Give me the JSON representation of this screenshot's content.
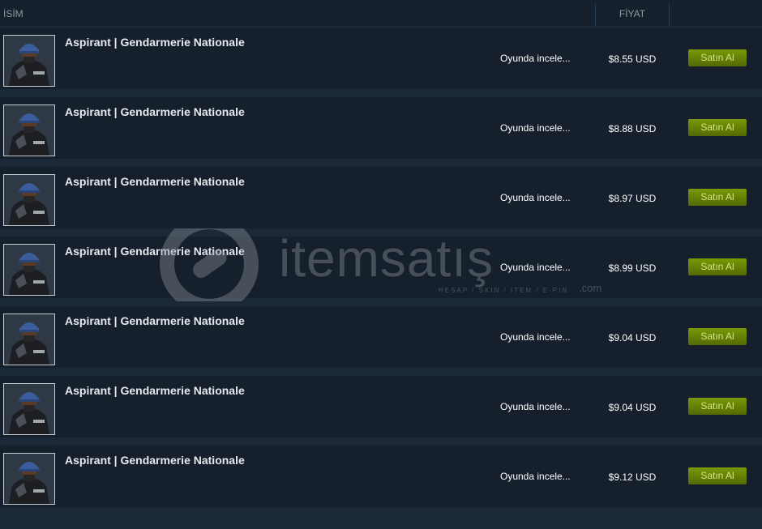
{
  "header": {
    "name_label": "İSİM",
    "price_label": "FİYAT"
  },
  "rows": [
    {
      "name": "Aspirant | Gendarmerie Nationale",
      "inspect": "Oyunda incele...",
      "price": "$8.55 USD",
      "buy": "Satın Al"
    },
    {
      "name": "Aspirant | Gendarmerie Nationale",
      "inspect": "Oyunda incele...",
      "price": "$8.88 USD",
      "buy": "Satın Al"
    },
    {
      "name": "Aspirant | Gendarmerie Nationale",
      "inspect": "Oyunda incele...",
      "price": "$8.97 USD",
      "buy": "Satın Al"
    },
    {
      "name": "Aspirant | Gendarmerie Nationale",
      "inspect": "Oyunda incele...",
      "price": "$8.99 USD",
      "buy": "Satın Al"
    },
    {
      "name": "Aspirant | Gendarmerie Nationale",
      "inspect": "Oyunda incele...",
      "price": "$9.04 USD",
      "buy": "Satın Al"
    },
    {
      "name": "Aspirant | Gendarmerie Nationale",
      "inspect": "Oyunda incele...",
      "price": "$9.04 USD",
      "buy": "Satın Al"
    },
    {
      "name": "Aspirant | Gendarmerie Nationale",
      "inspect": "Oyunda incele...",
      "price": "$9.12 USD",
      "buy": "Satın Al"
    }
  ],
  "watermark": {
    "brand": "itemsatış",
    "tagline": "HESAP / SKIN / ITEM / E-PIN",
    "domain": ".com"
  },
  "colors": {
    "background": "#1b2838",
    "row": "#16202d",
    "buy_button": "#799905",
    "buy_text": "#d2e885"
  }
}
